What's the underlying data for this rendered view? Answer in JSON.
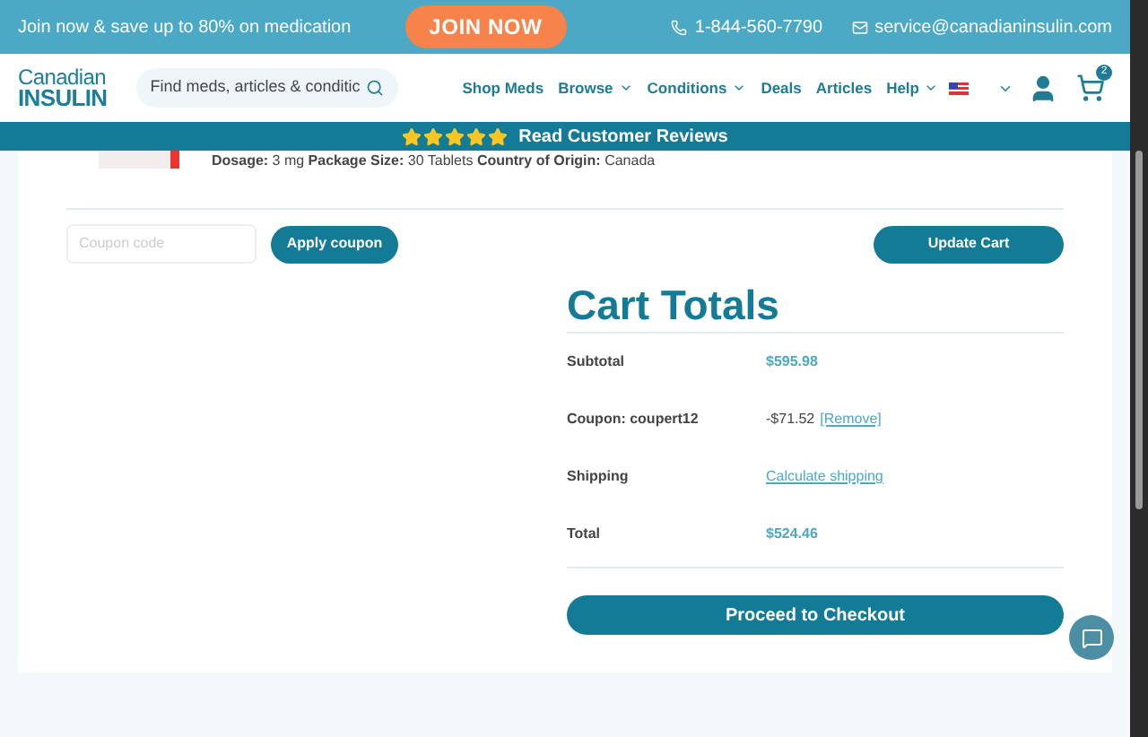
{
  "promo_bar": {
    "text": "Join now & save up to 80% on medication",
    "button": "JOIN NOW",
    "phone": "1-844-560-7790",
    "email": "service@canadianinsulin.com"
  },
  "header": {
    "logo_top": "Canadian",
    "logo_bottom": "INSULIN",
    "search": {
      "placeholder": "Find meds, articles & conditic"
    },
    "nav": [
      {
        "label": "Shop Meds",
        "dropdown": false
      },
      {
        "label": "Browse",
        "dropdown": true
      },
      {
        "label": "Conditions",
        "dropdown": true
      },
      {
        "label": "Deals",
        "dropdown": false
      },
      {
        "label": "Articles",
        "dropdown": false
      },
      {
        "label": "Help",
        "dropdown": true
      }
    ],
    "cart_count": "2"
  },
  "reviews_bar": {
    "stars": 5,
    "label": "Read Customer Reviews"
  },
  "cart_item": {
    "details": "**Dosage:** 3 mg **Package Size:** 30 Tablets **Country of Origin:** Canada"
  },
  "coupon": {
    "placeholder": "Coupon code",
    "apply": "Apply coupon",
    "update": "Update Cart"
  },
  "totals": {
    "title": "Cart Totals",
    "rows": [
      {
        "label": "Subtotal",
        "kind": "amount",
        "value": "$595.98"
      },
      {
        "label": "Coupon: coupert12",
        "kind": "discount",
        "value": "-$71.52",
        "link": "[Remove]"
      },
      {
        "label": "Shipping",
        "kind": "link",
        "value": "Calculate shipping"
      },
      {
        "label": "Total",
        "kind": "amount",
        "value": "$524.46"
      }
    ],
    "checkout": "Proceed to Checkout"
  }
}
